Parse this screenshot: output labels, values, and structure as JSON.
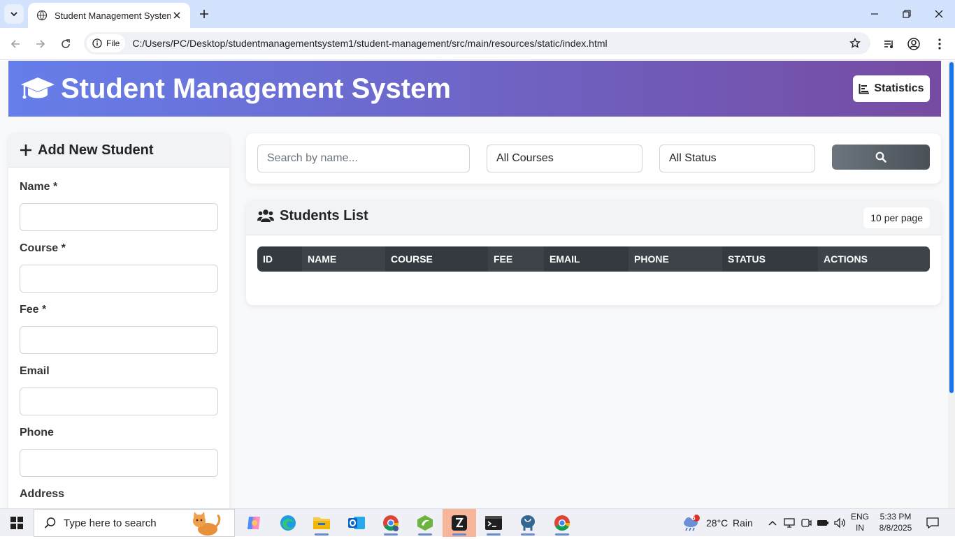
{
  "browser": {
    "tab_title": "Student Management System",
    "file_chip": "File",
    "url": "C:/Users/PC/Desktop/studentmanagementsystem1/student-management/src/main/resources/static/index.html"
  },
  "header": {
    "title": "Student Management System",
    "stats_label": "Statistics",
    "icon": "graduation-cap-icon"
  },
  "form": {
    "title": "Add New Student",
    "fields": [
      {
        "label": "Name *"
      },
      {
        "label": "Course *"
      },
      {
        "label": "Fee *"
      },
      {
        "label": "Email"
      },
      {
        "label": "Phone"
      },
      {
        "label": "Address"
      }
    ]
  },
  "filters": {
    "search_placeholder": "Search by name...",
    "course_selected": "All Courses",
    "status_selected": "All Status"
  },
  "list": {
    "title": "Students List",
    "per_page": "10 per page",
    "columns": [
      "ID",
      "NAME",
      "COURSE",
      "FEE",
      "EMAIL",
      "PHONE",
      "STATUS",
      "ACTIONS"
    ]
  },
  "taskbar": {
    "search_placeholder": "Type here to search",
    "weather_temp": "28°C",
    "weather_text": "Rain",
    "weather_badge": "5",
    "lang_line1": "ENG",
    "lang_line2": "IN",
    "time": "5:33 PM",
    "date": "8/8/2025"
  },
  "colors": {
    "header_gradient_start": "#667eea",
    "header_gradient_end": "#764ba2",
    "table_header": "#343a40"
  }
}
